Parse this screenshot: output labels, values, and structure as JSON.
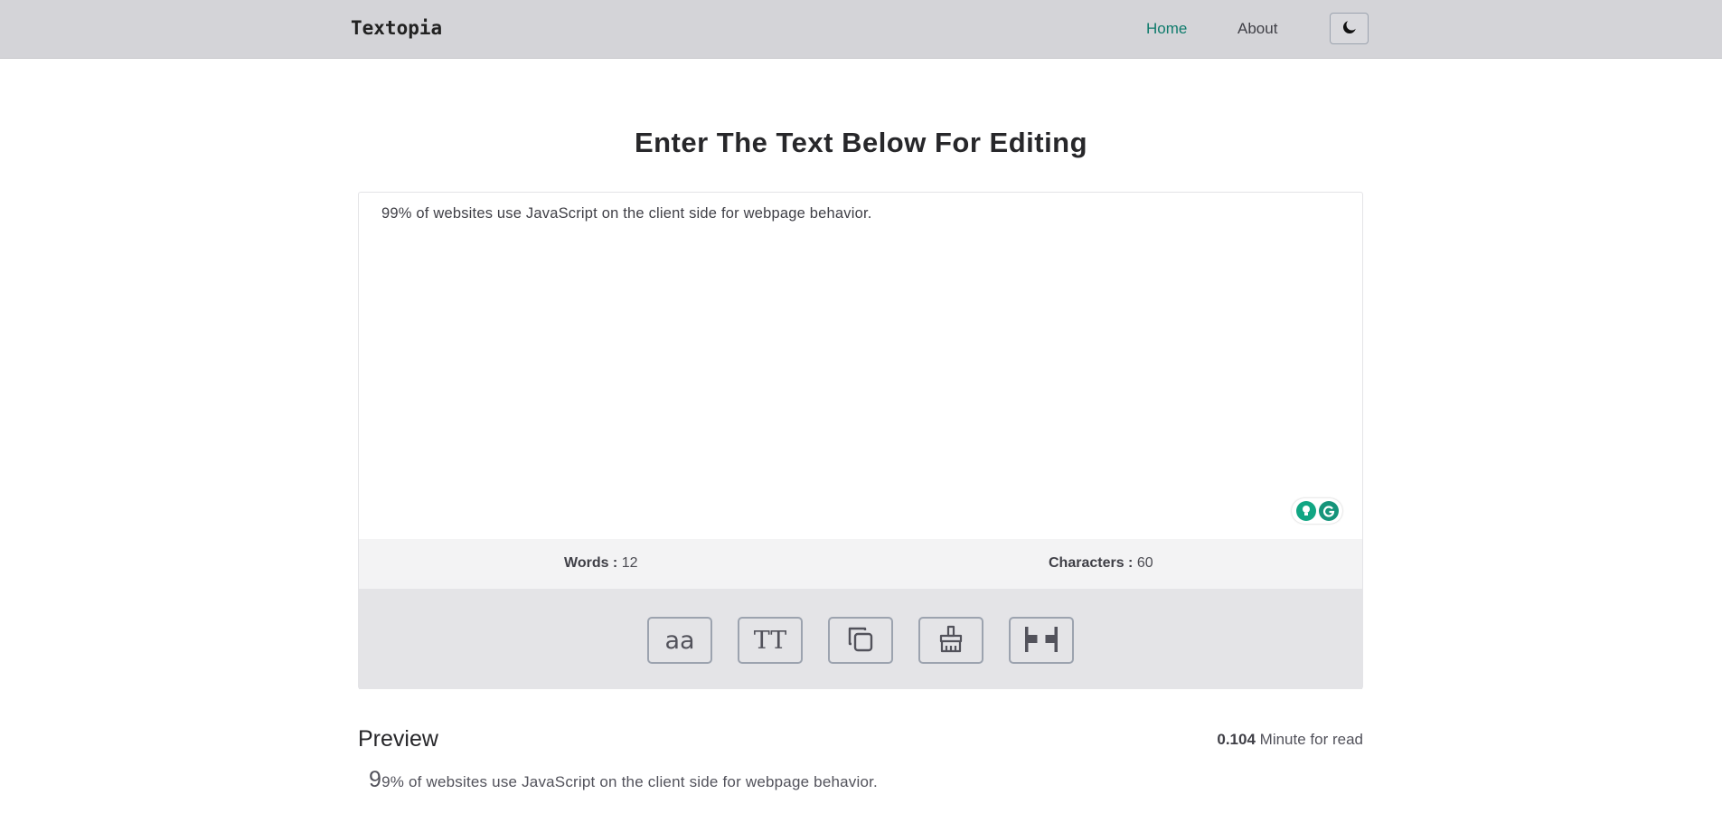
{
  "nav": {
    "brand": "Textopia",
    "home_label": "Home",
    "about_label": "About",
    "theme_icon": "moon-icon",
    "active_color": "#0f7b6c"
  },
  "main": {
    "heading": "Enter The Text Below For Editing",
    "textarea_value": "99% of websites use JavaScript on the client side for webpage behavior."
  },
  "stats": {
    "words_label": "Words :",
    "words_value": "12",
    "chars_label": "Characters :",
    "chars_value": "60"
  },
  "toolbar": {
    "lowercase_label": "aa",
    "uppercase_label": "TT",
    "copy_icon": "copy-icon",
    "clear_icon": "broom-icon",
    "space_icon": "remove-spaces-icon"
  },
  "preview": {
    "title": "Preview",
    "read_time_value": "0.104",
    "read_time_label": "Minute for read",
    "text_first": "9",
    "text_rest": "9% of websites use JavaScript on the client side for webpage behavior."
  }
}
